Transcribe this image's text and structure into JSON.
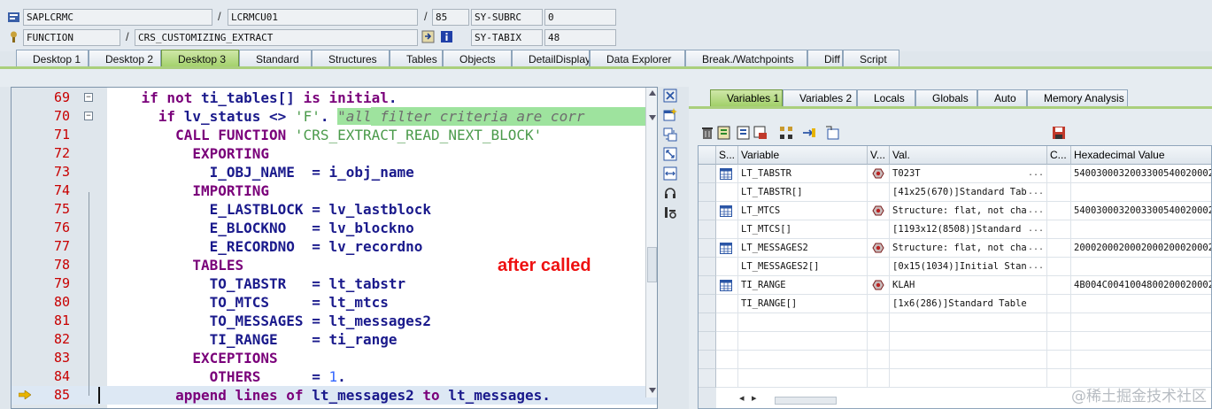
{
  "header": {
    "program": "SAPLCRMC",
    "include": "LCRMCU01",
    "line": "85",
    "sy_subrc_label": "SY-SUBRC",
    "sy_subrc_value": "0",
    "event_type": "FUNCTION",
    "event_name": "CRS_CUSTOMIZING_EXTRACT",
    "sy_tabix_label": "SY-TABIX",
    "sy_tabix_value": "48",
    "separator": "/"
  },
  "desktop_tabs": [
    {
      "label": "Desktop 1",
      "active": false
    },
    {
      "label": "Desktop 2",
      "active": false
    },
    {
      "label": "Desktop 3",
      "active": true
    },
    {
      "label": "Standard",
      "active": false
    },
    {
      "label": "Structures",
      "active": false
    },
    {
      "label": "Tables",
      "active": false
    },
    {
      "label": "Objects",
      "active": false
    },
    {
      "label": "DetailDisplay",
      "active": false
    },
    {
      "label": "Data Explorer",
      "active": false
    },
    {
      "label": "Break./Watchpoints",
      "active": false
    },
    {
      "label": "Diff",
      "active": false
    },
    {
      "label": "Script",
      "active": false
    }
  ],
  "editor": {
    "lines": [
      {
        "num": "69",
        "parts": [
          {
            "t": "    ",
            "c": ""
          },
          {
            "t": "if not ",
            "c": "kw"
          },
          {
            "t": "ti_tables[] ",
            "c": ""
          },
          {
            "t": "is initial",
            "c": "kw"
          },
          {
            "t": ".",
            "c": ""
          }
        ]
      },
      {
        "num": "70",
        "parts": [
          {
            "t": "      ",
            "c": ""
          },
          {
            "t": "if ",
            "c": "kw"
          },
          {
            "t": "lv_status <> ",
            "c": ""
          },
          {
            "t": "'F'",
            "c": "str"
          },
          {
            "t": ". ",
            "c": ""
          },
          {
            "t": "\"all filter criteria are corr",
            "c": "cmt"
          }
        ]
      },
      {
        "num": "71",
        "parts": [
          {
            "t": "        ",
            "c": ""
          },
          {
            "t": "CALL FUNCTION ",
            "c": "kw"
          },
          {
            "t": "'CRS_EXTRACT_READ_NEXT_BLOCK'",
            "c": "str"
          }
        ]
      },
      {
        "num": "72",
        "parts": [
          {
            "t": "          ",
            "c": ""
          },
          {
            "t": "EXPORTING",
            "c": "kw"
          }
        ]
      },
      {
        "num": "73",
        "parts": [
          {
            "t": "            I_OBJ_NAME  = i_obj_name",
            "c": ""
          }
        ]
      },
      {
        "num": "74",
        "parts": [
          {
            "t": "          ",
            "c": ""
          },
          {
            "t": "IMPORTING",
            "c": "kw"
          }
        ]
      },
      {
        "num": "75",
        "parts": [
          {
            "t": "            E_LASTBLOCK = lv_lastblock",
            "c": ""
          }
        ]
      },
      {
        "num": "76",
        "parts": [
          {
            "t": "            E_BLOCKNO   = lv_blockno",
            "c": ""
          }
        ]
      },
      {
        "num": "77",
        "parts": [
          {
            "t": "            E_RECORDNO  = lv_recordno",
            "c": ""
          }
        ]
      },
      {
        "num": "78",
        "parts": [
          {
            "t": "          ",
            "c": ""
          },
          {
            "t": "TABLES",
            "c": "kw"
          }
        ]
      },
      {
        "num": "79",
        "parts": [
          {
            "t": "            TO_TABSTR   = lt_tabstr",
            "c": ""
          }
        ]
      },
      {
        "num": "80",
        "parts": [
          {
            "t": "            TO_MTCS     = lt_mtcs",
            "c": ""
          }
        ]
      },
      {
        "num": "81",
        "parts": [
          {
            "t": "            TO_MESSAGES = lt_messages2",
            "c": ""
          }
        ]
      },
      {
        "num": "82",
        "parts": [
          {
            "t": "            TI_RANGE    = ti_range",
            "c": ""
          }
        ]
      },
      {
        "num": "83",
        "parts": [
          {
            "t": "          ",
            "c": ""
          },
          {
            "t": "EXCEPTIONS",
            "c": "kw"
          }
        ]
      },
      {
        "num": "84",
        "parts": [
          {
            "t": "            ",
            "c": ""
          },
          {
            "t": "OTHERS      ",
            "c": "kw"
          },
          {
            "t": "= ",
            "c": ""
          },
          {
            "t": "1",
            "c": "num"
          },
          {
            "t": ".",
            "c": ""
          }
        ]
      },
      {
        "num": "85",
        "parts": [
          {
            "t": "        ",
            "c": ""
          },
          {
            "t": "append lines of ",
            "c": "kw"
          },
          {
            "t": "lt_messages2 ",
            "c": ""
          },
          {
            "t": "to ",
            "c": "kw"
          },
          {
            "t": "lt_messages",
            "c": ""
          },
          {
            "t": ".",
            "c": ""
          }
        ]
      }
    ],
    "annotation": "after called"
  },
  "variable_tabs": [
    {
      "label": "Variables 1",
      "active": true
    },
    {
      "label": "Variables 2",
      "active": false
    },
    {
      "label": "Locals",
      "active": false
    },
    {
      "label": "Globals",
      "active": false
    },
    {
      "label": "Auto",
      "active": false
    },
    {
      "label": "Memory Analysis",
      "active": false
    }
  ],
  "grid": {
    "headers": {
      "s": "S...",
      "variable": "Variable",
      "v": "V...",
      "value": "Val.",
      "c": "C...",
      "hex": "Hexadecimal Value"
    },
    "rows": [
      {
        "variable": "LT_TABSTR",
        "value": "T023T",
        "hex": "5400300032003300540020002",
        "icon": true,
        "ellipsis": true
      },
      {
        "variable": "LT_TABSTR[]",
        "value": "[41x25(670)]Standard Tab",
        "hex": "",
        "icon": false,
        "ellipsis": true
      },
      {
        "variable": "LT_MTCS",
        "value": "Structure: flat, not cha",
        "hex": "5400300032003300540020002",
        "icon": true,
        "ellipsis": true
      },
      {
        "variable": "LT_MTCS[]",
        "value": "[1193x12(8508)]Standard",
        "hex": "",
        "icon": false,
        "ellipsis": true
      },
      {
        "variable": "LT_MESSAGES2",
        "value": "Structure: flat, not cha",
        "hex": "2000200020002000200020002",
        "icon": true,
        "ellipsis": true
      },
      {
        "variable": "LT_MESSAGES2[]",
        "value": "[0x15(1034)]Initial Stan",
        "hex": "",
        "icon": false,
        "ellipsis": true
      },
      {
        "variable": "TI_RANGE",
        "value": "KLAH",
        "hex": "4B004C0041004800200020002",
        "icon": true,
        "ellipsis": false
      },
      {
        "variable": "TI_RANGE[]",
        "value": "[1x6(286)]Standard Table",
        "hex": "",
        "icon": false,
        "ellipsis": false
      }
    ],
    "ellipsis": "...",
    "scroll_left": "◂",
    "scroll_right": "▸"
  },
  "watermark": "@稀土掘金技术社区",
  "colors": {
    "accent_green": "#9fcf66",
    "line_number": "#c80000",
    "keyword": "#7a007a",
    "annotation": "#ee1111"
  }
}
